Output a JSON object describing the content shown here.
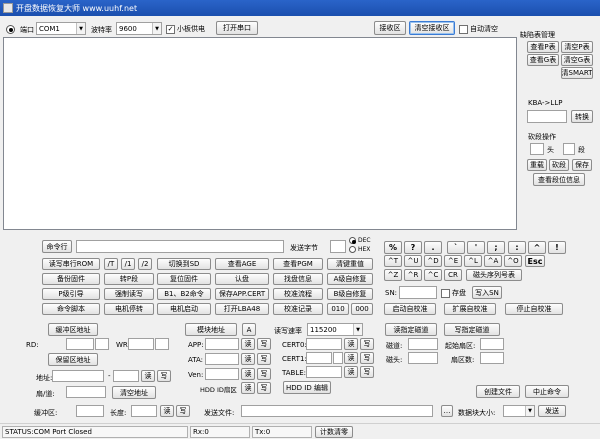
{
  "window": {
    "title": "开盘数据恢复大师 www.uuhf.net"
  },
  "top": {
    "port_label": "端口",
    "port_value": "COM1",
    "baud_label": "波特率",
    "baud_value": "9600",
    "board_power_label": "小板供电",
    "board_power_checked": true,
    "open_port": "打开串口",
    "receive_area": "接收区",
    "clear_receive": "清空接收区",
    "auto_clear": "自动清空"
  },
  "right": {
    "defect_title": "缺陷表管理",
    "btns": [
      "查看P表",
      "清空P表",
      "查看G表",
      "清空G表",
      "清SMART"
    ],
    "kba_label": "KBA->LLP",
    "convert": "转换",
    "cut_title": "砍段操作",
    "head_label": "头",
    "seg_label": "段",
    "cut_btns": [
      "重载",
      "砍段",
      "保存"
    ],
    "view_seg": "查看段位信息"
  },
  "cmd": {
    "cmd_line": "命令行",
    "send_byte": "发送字节",
    "radio_dec": "DEC",
    "radio_hex": "HEX",
    "row1": [
      "读写串行ROM",
      "/T",
      "/1",
      "/2",
      "切换到SD",
      "查看AGE",
      "查看PGM",
      "清键重值"
    ],
    "row2": [
      "备份固件",
      "转P段",
      "复位固件",
      "认盘",
      "找盘信息",
      "A级自修复"
    ],
    "row3": [
      "P级引导",
      "强制读写",
      "B1、B2命令",
      "保存APP.CERT",
      "校准流程",
      "B级自修复"
    ],
    "row4": [
      "命令脚本",
      "电机停转",
      "电机启动",
      "打开LBA48",
      "校准记录",
      "010",
      "000"
    ],
    "keys1": [
      "%",
      "?",
      ".",
      "`",
      "'",
      ";",
      ":",
      "^",
      "!"
    ],
    "keys2": [
      "^T",
      "^U",
      "^D",
      "^E",
      "^L",
      "^A",
      "^O",
      "Esc"
    ],
    "keys3": [
      "^Z",
      "^R",
      "^C",
      "CR",
      "磁头序列号表"
    ],
    "sn_label": "SN:",
    "save_label": "存盘",
    "write_sn": "写入SN",
    "auto_btns": [
      "启动自校准",
      "扩展自校准",
      "停止自校准"
    ]
  },
  "buffer": {
    "buffer_addr": "缓冲区地址",
    "rd_label": "RD:",
    "wr_label": "WR:",
    "keep_addr": "保留区地址",
    "addr_label": "地址:",
    "dash": "-",
    "read": "读",
    "write": "写",
    "cyl_label": "扇/道:",
    "clear_addr": "清空地址",
    "buffer_label": "缓冲区:",
    "len_label": "长度:"
  },
  "module": {
    "module_addr": "模块地址",
    "a_btn": "A",
    "app": "APP:",
    "ata": "ATA:",
    "ven": "Ven:",
    "read": "读",
    "write": "写",
    "hdd_zone": "HDD ID扇区",
    "send_file": "发送文件:"
  },
  "rw": {
    "speed_label": "读写速率",
    "speed_value": "115200",
    "cert0": "CERT0:",
    "cert1": "CERT1:",
    "table": "TABLE:",
    "hdd_edit": "HDD ID 编辑"
  },
  "track": {
    "read_track": "读指定磁道",
    "write_track": "写指定磁道",
    "track_label": "磁道:",
    "start_sector": "起始扇区:",
    "head_label": "磁头:",
    "sector_count": "扇区数:",
    "create_file": "创建文件",
    "abort": "中止命令",
    "block_size": "数据块大小:",
    "send": "发送"
  },
  "status": {
    "text": "STATUS:COM Port Closed",
    "rx": "Rx:0",
    "tx": "Tx:0",
    "clear_count": "计数清零"
  }
}
